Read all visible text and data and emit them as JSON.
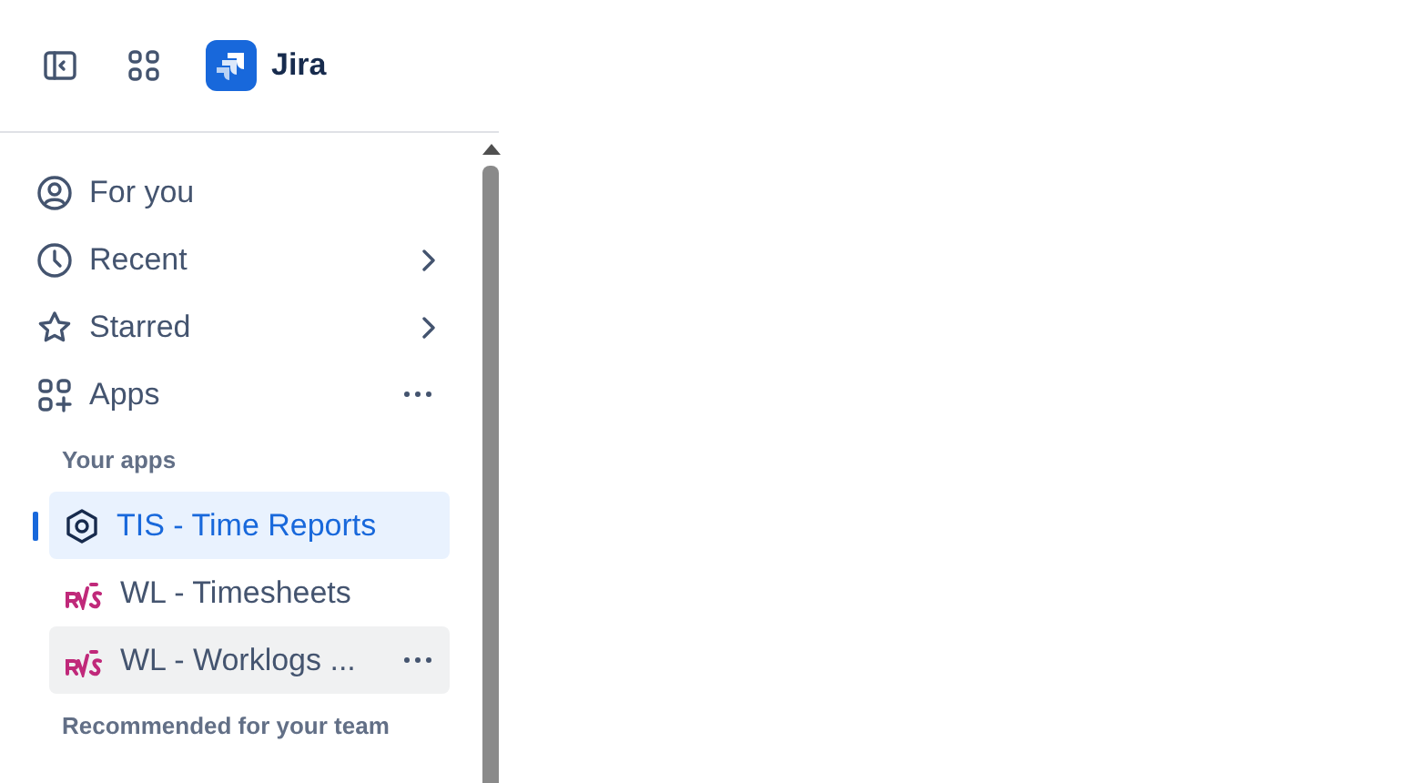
{
  "header": {
    "product": "Jira"
  },
  "nav": [
    {
      "label": "For you",
      "chevron": false,
      "more": false
    },
    {
      "label": "Recent",
      "chevron": true,
      "more": false
    },
    {
      "label": "Starred",
      "chevron": true,
      "more": false
    },
    {
      "label": "Apps",
      "chevron": false,
      "more": true
    }
  ],
  "your_apps": {
    "heading": "Your apps",
    "items": [
      {
        "label": "TIS - Time Reports",
        "selected": true,
        "hovered": false
      },
      {
        "label": "WL - Timesheets",
        "selected": false,
        "hovered": false
      },
      {
        "label": "WL - Worklogs ...",
        "selected": false,
        "hovered": true
      }
    ]
  },
  "recommended": {
    "heading": "Recommended for your team"
  }
}
